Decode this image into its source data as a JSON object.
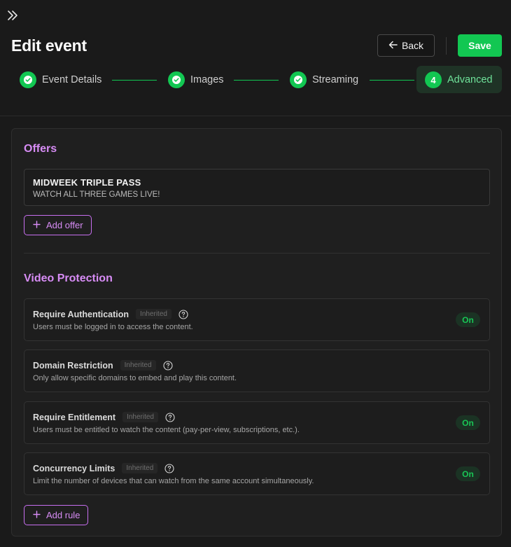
{
  "header": {
    "title": "Edit event",
    "back_label": "Back",
    "save_label": "Save"
  },
  "stepper": {
    "steps": [
      {
        "label": "Event Details",
        "status": "complete"
      },
      {
        "label": "Images",
        "status": "complete"
      },
      {
        "label": "Streaming",
        "status": "complete"
      },
      {
        "label": "Advanced",
        "status": "active",
        "number": "4"
      }
    ]
  },
  "offers": {
    "title": "Offers",
    "items": [
      {
        "name": "MIDWEEK TRIPLE PASS",
        "description": "WATCH ALL THREE GAMES LIVE!"
      }
    ],
    "add_label": "Add offer"
  },
  "protection": {
    "title": "Video Protection",
    "rules": [
      {
        "title": "Require Authentication",
        "badge": "Inherited",
        "description": "Users must be logged in to access the content.",
        "state": "On"
      },
      {
        "title": "Domain Restriction",
        "badge": "Inherited",
        "description": "Only allow specific domains to embed and play this content.",
        "state": null
      },
      {
        "title": "Require Entitlement",
        "badge": "Inherited",
        "description": "Users must be entitled to watch the content (pay-per-view, subscriptions, etc.).",
        "state": "On"
      },
      {
        "title": "Concurrency Limits",
        "badge": "Inherited",
        "description": "Limit the number of devices that can watch from the same account simultaneously.",
        "state": "On"
      }
    ],
    "add_label": "Add rule"
  },
  "colors": {
    "accent_green": "#12c752",
    "accent_purple": "#d78cf5",
    "background": "#1a1a1a"
  },
  "icons": {
    "collapse": "double-chevron-right-icon",
    "back": "arrow-left-icon",
    "check": "check-icon",
    "add": "plus-icon",
    "help": "question-circle-icon"
  }
}
